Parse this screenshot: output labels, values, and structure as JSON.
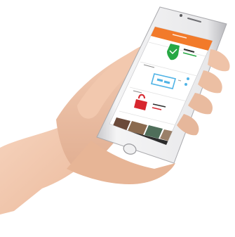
{
  "colors": {
    "app_bar": "#f27a2a",
    "security_green": "#27a844",
    "thermostat_blue": "#4fb3e6",
    "lock_red": "#d7262e",
    "nav_bar": "#2b2b2b",
    "phone_silver": "#e6e6e8",
    "skin": "#efc3a8"
  },
  "icons": {
    "security": "shield-check-icon",
    "thermostat": "thermostat-display-icon",
    "lock": "padlock-icon",
    "home_button": "home-button-icon"
  }
}
